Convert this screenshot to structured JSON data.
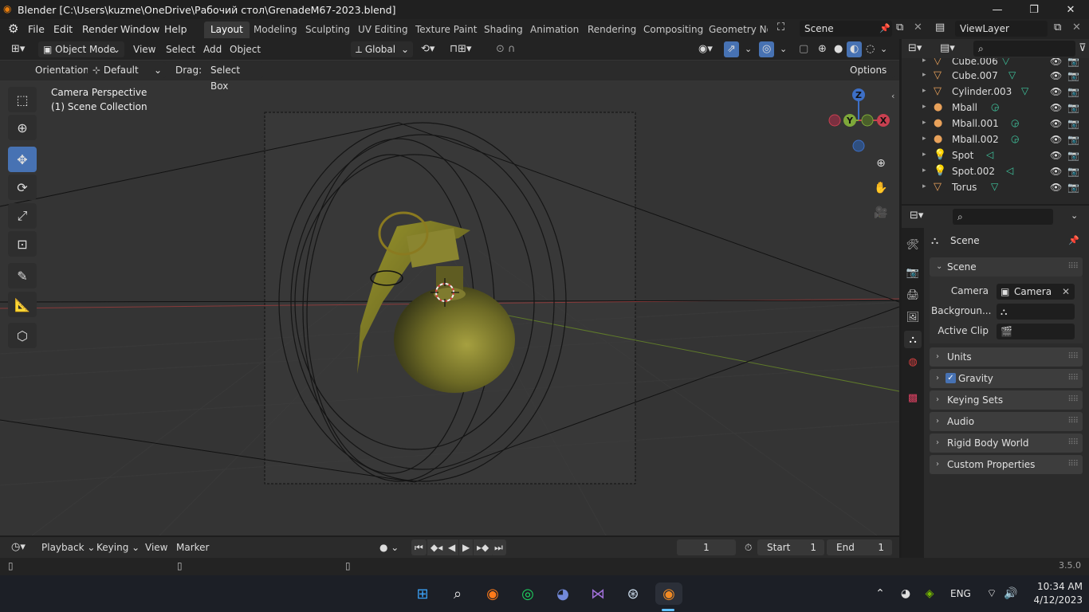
{
  "window": {
    "title": "Blender [C:\\Users\\kuzme\\OneDrive\\Рабочий стол\\GrenadeM67-2023.blend]"
  },
  "menubar": {
    "menus": [
      "File",
      "Edit",
      "Render",
      "Window",
      "Help"
    ],
    "workspaces": [
      "Layout",
      "Modeling",
      "Sculpting",
      "UV Editing",
      "Texture Paint",
      "Shading",
      "Animation",
      "Rendering",
      "Compositing",
      "Geometry Noc"
    ],
    "active_workspace": "Layout",
    "scene_name": "Scene",
    "view_layer": "ViewLayer"
  },
  "viewport": {
    "mode": "Object Mode",
    "menus": [
      "View",
      "Select",
      "Add",
      "Object"
    ],
    "transform_orientation": "Global",
    "orientation_label": "Orientation:",
    "orientation_value": "Default",
    "drag_label": "Drag:",
    "drag_value": "Select Box",
    "options_label": "Options",
    "overlay_title": "Camera Perspective",
    "overlay_subtitle": "(1) Scene Collection",
    "gizmo_axes": {
      "z": "Z",
      "y": "Y",
      "x": "X"
    }
  },
  "outliner": {
    "items": [
      {
        "name": "Cube.006",
        "type": "mesh"
      },
      {
        "name": "Cube.007",
        "type": "mesh"
      },
      {
        "name": "Cylinder.003",
        "type": "mesh"
      },
      {
        "name": "Mball",
        "type": "metaball"
      },
      {
        "name": "Mball.001",
        "type": "metaball"
      },
      {
        "name": "Mball.002",
        "type": "metaball"
      },
      {
        "name": "Spot",
        "type": "light"
      },
      {
        "name": "Spot.002",
        "type": "light"
      },
      {
        "name": "Torus",
        "type": "mesh"
      }
    ]
  },
  "properties": {
    "context": "Scene",
    "scene_panel": "Scene",
    "camera_label": "Camera",
    "camera_value": "Camera",
    "background_label": "Backgroun...",
    "active_clip_label": "Active Clip",
    "panels": [
      "Units",
      "Gravity",
      "Keying Sets",
      "Audio",
      "Rigid Body World",
      "Custom Properties"
    ],
    "gravity_checked": true
  },
  "timeline": {
    "menus": [
      "Playback",
      "Keying",
      "View",
      "Marker"
    ],
    "current_frame": "1",
    "start_label": "Start",
    "start_value": "1",
    "end_label": "End",
    "end_value": "1"
  },
  "statusbar": {
    "version": "3.5.0"
  },
  "taskbar": {
    "language": "ENG",
    "time": "10:34 AM",
    "date": "4/12/2023"
  },
  "colors": {
    "accent": "#4772b3",
    "axis_x": "#c84050",
    "axis_y": "#7ea83a",
    "axis_z": "#3d6fc6"
  }
}
